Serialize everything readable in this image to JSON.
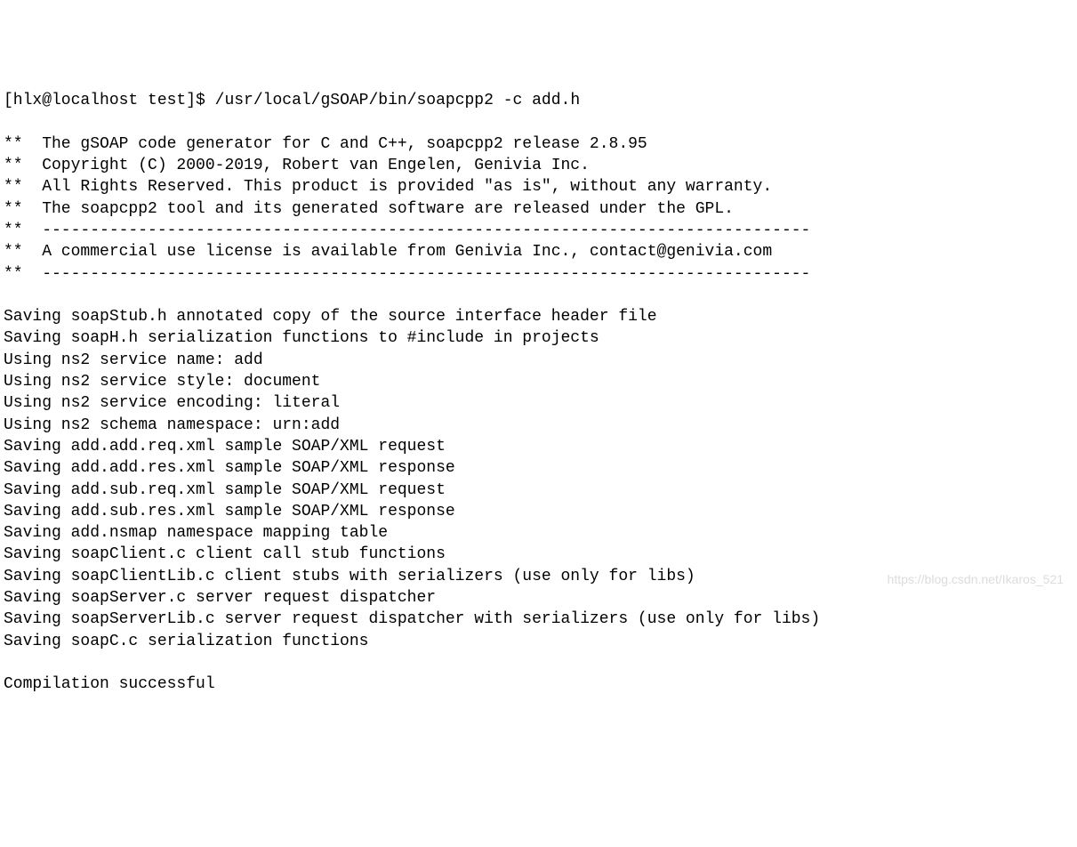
{
  "prompt": "[hlx@localhost test]$",
  "command": "/usr/local/gSOAP/bin/soapcpp2 -c add.h",
  "banner": {
    "l1": "**  The gSOAP code generator for C and C++, soapcpp2 release 2.8.95",
    "l2": "**  Copyright (C) 2000-2019, Robert van Engelen, Genivia Inc.",
    "l3": "**  All Rights Reserved. This product is provided \"as is\", without any warranty.",
    "l4": "**  The soapcpp2 tool and its generated software are released under the GPL.",
    "l5": "**  --------------------------------------------------------------------------------",
    "l6": "**  A commercial use license is available from Genivia Inc., contact@genivia.com",
    "l7": "**  --------------------------------------------------------------------------------"
  },
  "output": {
    "l1": "Saving soapStub.h annotated copy of the source interface header file",
    "l2": "Saving soapH.h serialization functions to #include in projects",
    "l3": "Using ns2 service name: add",
    "l4": "Using ns2 service style: document",
    "l5": "Using ns2 service encoding: literal",
    "l6": "Using ns2 schema namespace: urn:add",
    "l7": "Saving add.add.req.xml sample SOAP/XML request",
    "l8": "Saving add.add.res.xml sample SOAP/XML response",
    "l9": "Saving add.sub.req.xml sample SOAP/XML request",
    "l10": "Saving add.sub.res.xml sample SOAP/XML response",
    "l11": "Saving add.nsmap namespace mapping table",
    "l12": "Saving soapClient.c client call stub functions",
    "l13": "Saving soapClientLib.c client stubs with serializers (use only for libs)",
    "l14": "Saving soapServer.c server request dispatcher",
    "l15": "Saving soapServerLib.c server request dispatcher with serializers (use only for libs)",
    "l16": "Saving soapC.c serialization functions"
  },
  "result": "Compilation successful",
  "watermark": "https://blog.csdn.net/Ikaros_521"
}
